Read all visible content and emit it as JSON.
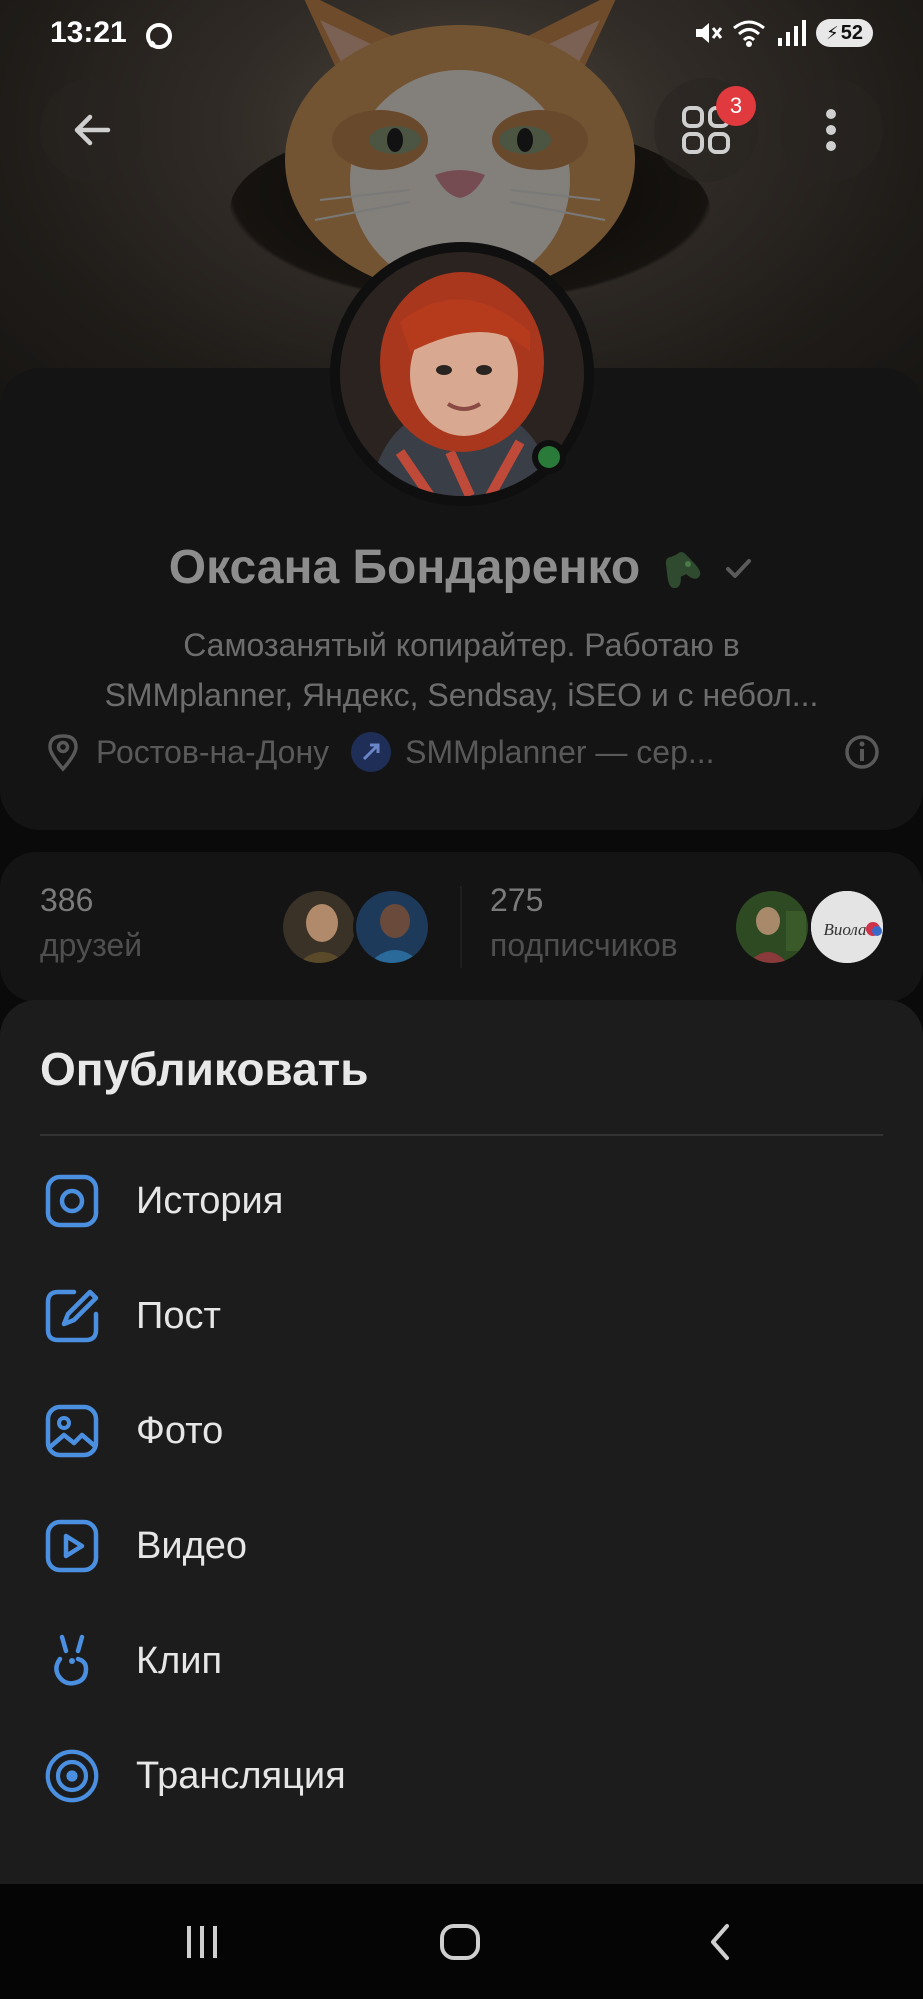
{
  "status_bar": {
    "time": "13:21",
    "battery": "52",
    "icons": [
      "chat-notification-icon",
      "mute-icon",
      "wifi-icon",
      "signal-icon",
      "battery-icon"
    ]
  },
  "header": {
    "apps_badge": "3",
    "icons": [
      "back-arrow-icon",
      "apps-grid-icon",
      "more-vertical-icon"
    ]
  },
  "profile": {
    "name": "Оксана Бондаренко",
    "bio_line1": "Самозанятый копирайтер. Работаю в",
    "bio_line2": "SMMplanner, Яндекс, Sendsay, iSEO и с небол...",
    "location": "Ростов-на-Дону",
    "link": "SMMplanner — сер...",
    "online": true
  },
  "stats": {
    "friends_count": "386",
    "friends_label": "друзей",
    "subscribers_count": "275",
    "subscribers_label": "подписчиков",
    "subscriber_logo_text": "Виола"
  },
  "sheet": {
    "title": "Опубликовать",
    "accent": "#4a8fe0",
    "items": [
      {
        "label": "История",
        "icon": "story-icon"
      },
      {
        "label": "Пост",
        "icon": "post-edit-icon"
      },
      {
        "label": "Фото",
        "icon": "photo-icon"
      },
      {
        "label": "Видео",
        "icon": "video-icon"
      },
      {
        "label": "Клип",
        "icon": "clip-icon"
      },
      {
        "label": "Трансляция",
        "icon": "broadcast-icon"
      }
    ]
  },
  "navbar": {
    "icons": [
      "recent-apps-icon",
      "home-icon",
      "back-icon"
    ]
  }
}
